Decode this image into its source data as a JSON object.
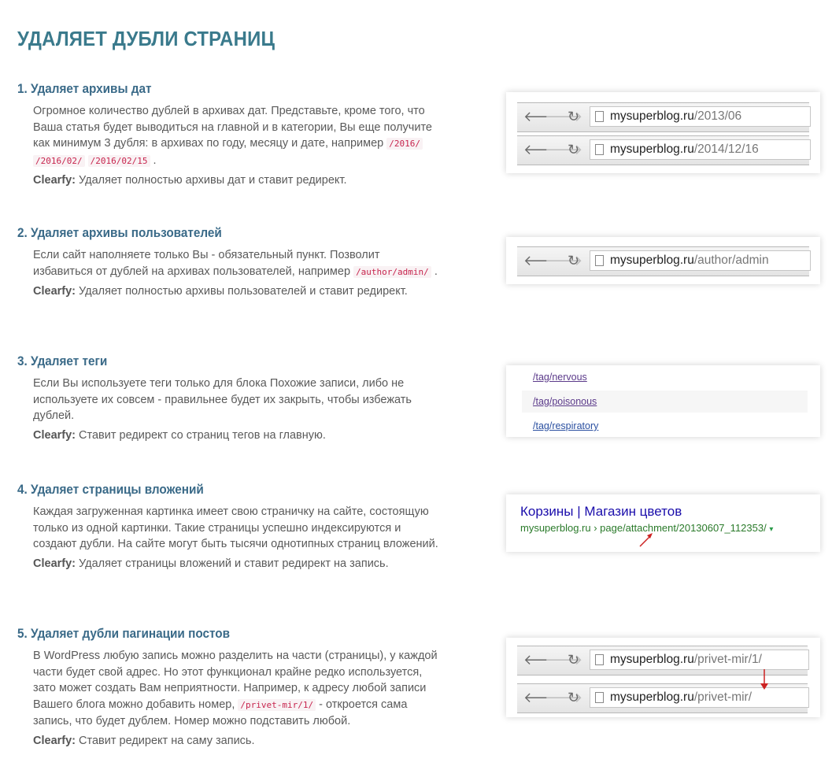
{
  "page": {
    "title": "УДАЛЯЕТ ДУБЛИ СТРАНИЦ"
  },
  "product_name": "Clearfy:",
  "sections": [
    {
      "heading": "1. Удаляет архивы дат",
      "description": "Огромное количество дублей в архивах дат. Представьте, кроме того, что Ваша статья будет выводиться на главной и в категории, Вы еще получите как минимум 3 дубля: в архивах по году, месяцу и дате, например",
      "codes": [
        "/2016/",
        "/2016/02/",
        "/2016/02/15"
      ],
      "description_end": ".",
      "action": "Удаляет полностью архивы дат и ставит редирект.",
      "browser_urls": [
        {
          "host": "mysuperblog.ru",
          "path": "/2013/06"
        },
        {
          "host": "mysuperblog.ru",
          "path": "/2014/12/16"
        }
      ]
    },
    {
      "heading": "2. Удаляет архивы пользователей",
      "description": "Если сайт наполняете только Вы - обязательный пункт. Позволит избавиться от дублей на архивах пользователей, например",
      "codes": [
        "/author/admin/"
      ],
      "description_end": ".",
      "action": "Удаляет полностью архивы пользователей и ставит редирект.",
      "browser_urls": [
        {
          "host": "mysuperblog.ru",
          "path": "/author/admin"
        }
      ]
    },
    {
      "heading": "3. Удаляет теги",
      "description": "Если Вы используете теги только для блока Похожие записи, либо не используете их совсем - правильнее будет их закрыть, чтобы избежать дублей.",
      "action": "Ставит редирект со страниц тегов на главную.",
      "tag_links": [
        "/tag/nervous",
        "/tag/poisonous",
        "/tag/respiratory"
      ]
    },
    {
      "heading": "4. Удаляет страницы вложений",
      "description": "Каждая загруженная картинка имеет свою страничку на сайте, состоящую только из одной картинки. Такие страницы успешно индексируются и создают дубли. На сайте могут быть тысячи однотипных страниц вложений.",
      "action": "Удаляет страницы вложений и ставит редирект на запись.",
      "serp": {
        "title": "Корзины | Магазин цветов",
        "url": "mysuperblog.ru › page/attachment/20130607_112353/",
        "caret": "▾"
      }
    },
    {
      "heading": "5. Удаляет дубли пагинации постов",
      "description": "В WordPress любую запись можно разделить на части (страницы), у каждой части будет свой адрес. Но этот функционал крайне редко используется, зато может создать Вам неприятности. Например, к адресу любой записи Вашего блога можно добавить номер,",
      "codes": [
        "/privet-mir/1/"
      ],
      "description_end": "- откроется сама запись, что будет дублем. Номер можно подставить любой.",
      "action": "Ставит редирект на саму запись.",
      "browser_urls": [
        {
          "host": "mysuperblog.ru",
          "path": "/privet-mir/1/"
        },
        {
          "host": "mysuperblog.ru",
          "path": "/privet-mir/"
        }
      ]
    }
  ],
  "icons": {
    "back": "arrow-left-icon",
    "forward": "arrow-right-icon",
    "reload": "reload-icon",
    "page": "page-icon"
  },
  "colors": {
    "title": "#3a7a8c",
    "heading": "#3a6a88",
    "code": "#c7254e",
    "arrow": "#cc2222"
  }
}
